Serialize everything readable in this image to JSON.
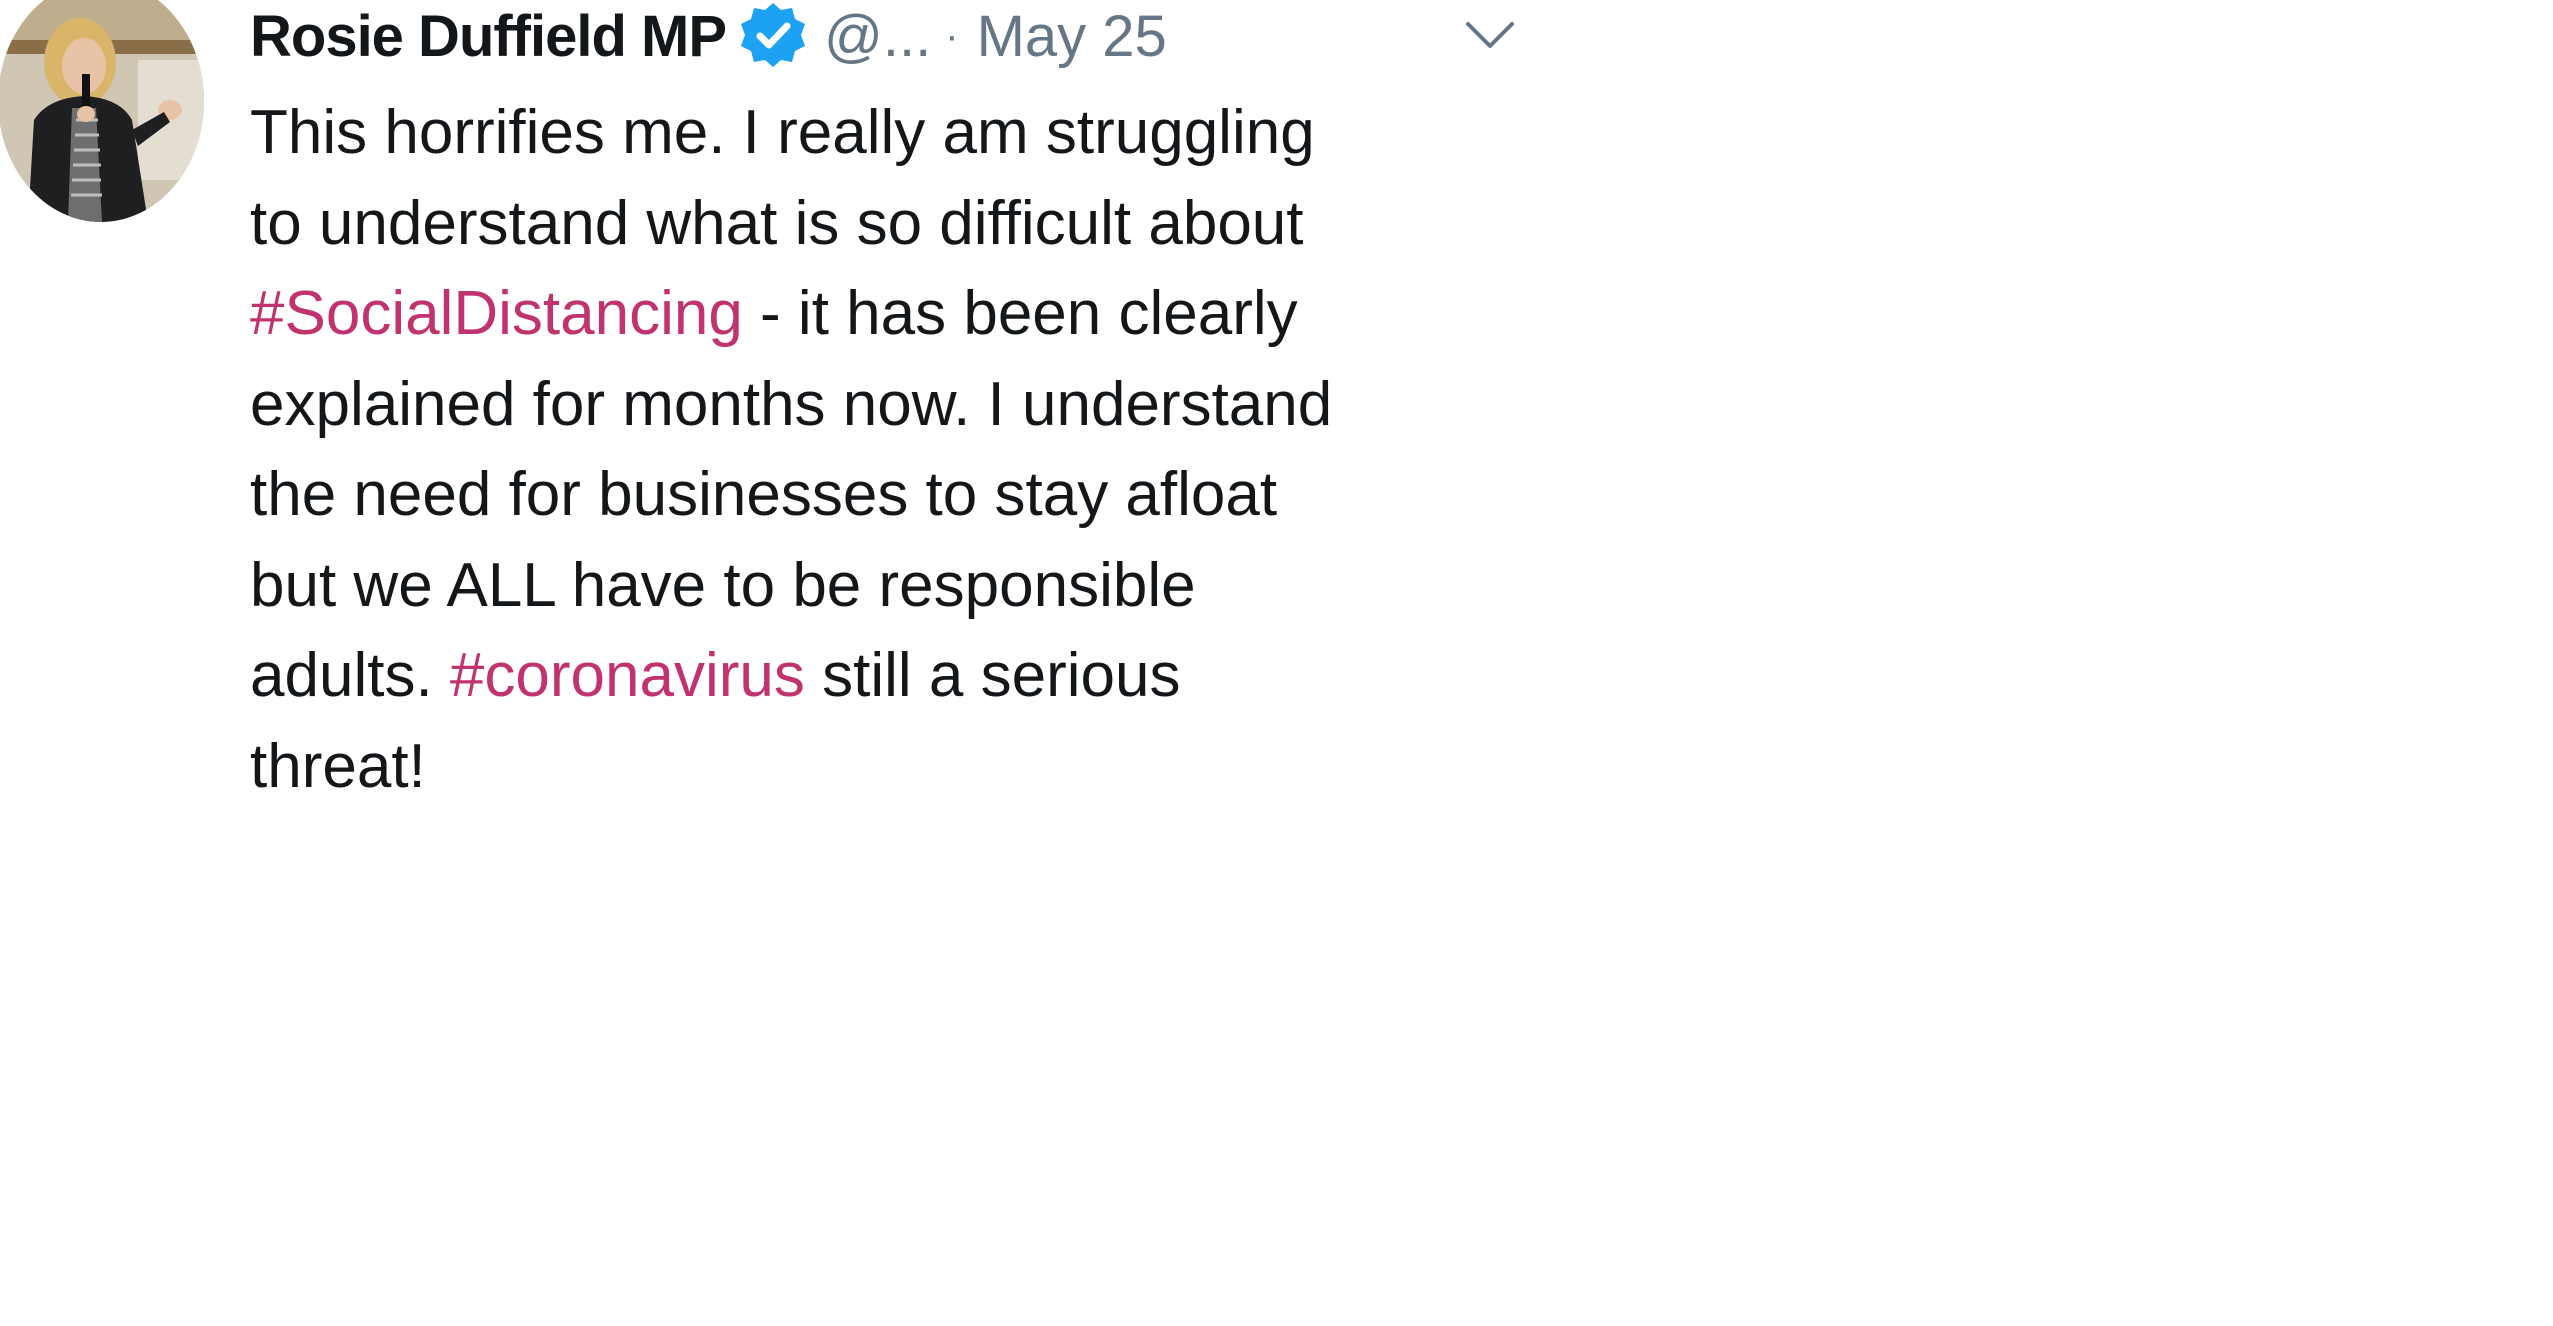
{
  "tweet": {
    "author": {
      "display_name": "Rosie Duffield MP",
      "handle": "@...",
      "verified": true,
      "verified_icon": "verified-badge-icon",
      "avatar": "profile-photo-avatar"
    },
    "separator": "·",
    "date": "May 25",
    "menu_icon": "chevron-down-icon",
    "text_lines": [
      {
        "parts": [
          {
            "text": "This horrifies me. I really am struggling",
            "hashtag": false
          }
        ]
      },
      {
        "parts": [
          {
            "text": "to understand what is so difficult about",
            "hashtag": false
          }
        ]
      },
      {
        "parts": [
          {
            "text": "#SocialDistancing",
            "hashtag": true
          },
          {
            "text": " - it has been clearly",
            "hashtag": false
          }
        ]
      },
      {
        "parts": [
          {
            "text": "explained for months now. I understand",
            "hashtag": false
          }
        ]
      },
      {
        "parts": [
          {
            "text": "the need for businesses to stay afloat",
            "hashtag": false
          }
        ]
      },
      {
        "parts": [
          {
            "text": "but we ALL have to be responsible",
            "hashtag": false
          }
        ]
      },
      {
        "parts": [
          {
            "text": "adults. ",
            "hashtag": false
          },
          {
            "text": "#coronavirus",
            "hashtag": true
          },
          {
            "text": " still a serious",
            "hashtag": false
          }
        ]
      },
      {
        "parts": [
          {
            "text": "threat!",
            "hashtag": false
          }
        ]
      }
    ]
  },
  "colors": {
    "text": "#14171a",
    "muted": "#657786",
    "hashtag": "#c0336f",
    "verified": "#1da1f2"
  }
}
